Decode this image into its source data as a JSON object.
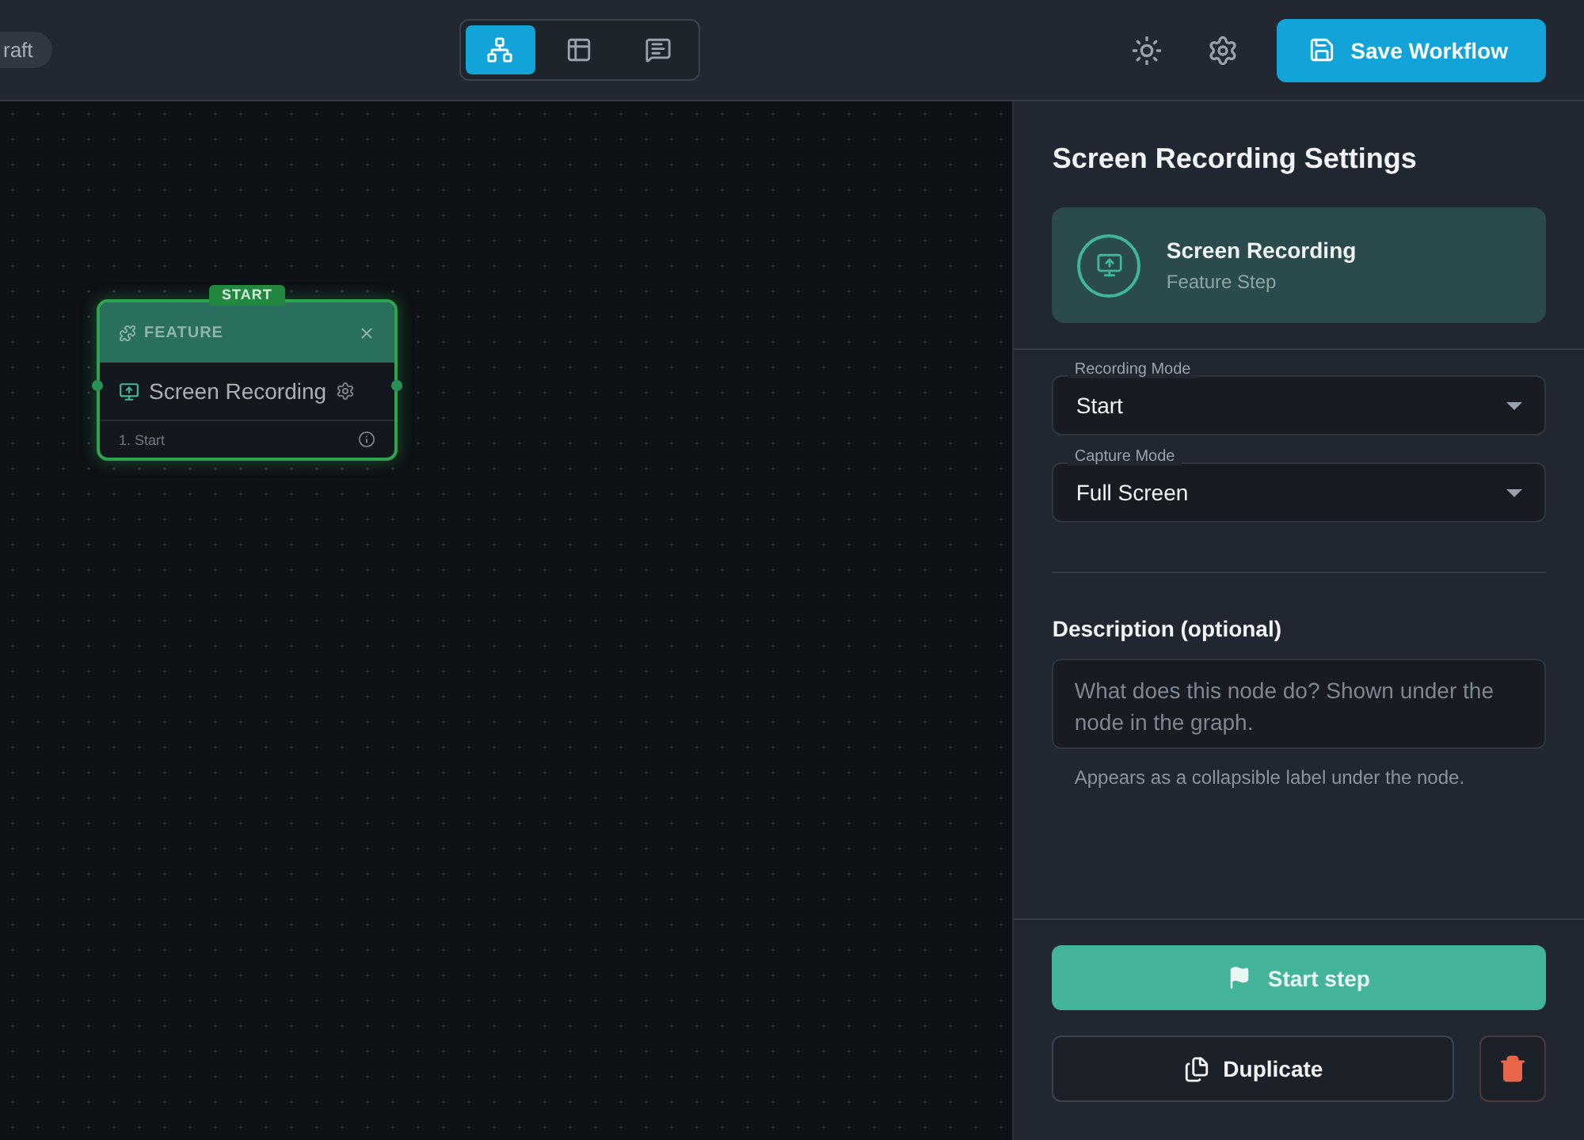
{
  "header": {
    "status_badge": "raft",
    "view_toggle": [
      {
        "kind": "diagram",
        "selected": true
      },
      {
        "kind": "table",
        "selected": false
      },
      {
        "kind": "comments",
        "selected": false
      }
    ],
    "save_button": "Save Workflow"
  },
  "canvas": {
    "node": {
      "badge": "START",
      "type_label": "FEATURE",
      "title": "Screen Recording",
      "footer": "1. Start",
      "selected": true
    }
  },
  "panel": {
    "title": "Screen Recording Settings",
    "summary": {
      "title": "Screen Recording",
      "subtitle": "Feature Step"
    },
    "fields": [
      {
        "label": "Recording Mode",
        "value": "Start"
      },
      {
        "label": "Capture Mode",
        "value": "Full Screen"
      }
    ],
    "description": {
      "label": "Description (optional)",
      "placeholder": "What does this node do? Shown under the node in the graph.",
      "hint": "Appears as a collapsible label under the node."
    },
    "primary_button": "Start step",
    "duplicate_button": "Duplicate"
  }
}
